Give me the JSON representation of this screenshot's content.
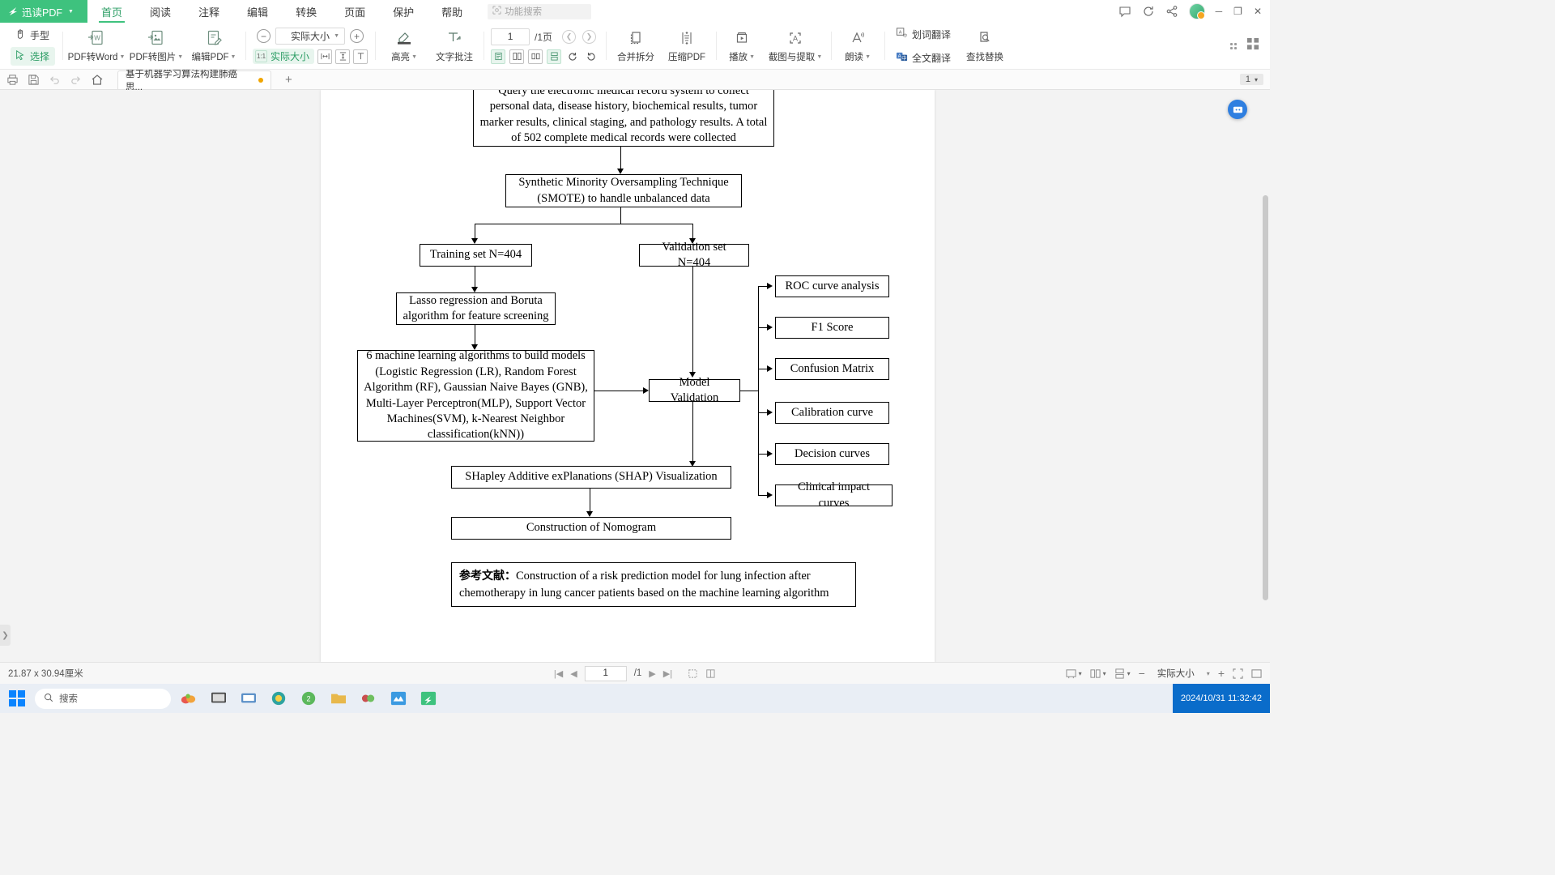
{
  "app": {
    "brand": "迅读PDF",
    "menu_tabs": [
      {
        "label": "首页",
        "active": true
      },
      {
        "label": "阅读",
        "active": false
      },
      {
        "label": "注释",
        "active": false
      },
      {
        "label": "编辑",
        "active": false
      },
      {
        "label": "转换",
        "active": false
      },
      {
        "label": "页面",
        "active": false
      },
      {
        "label": "保护",
        "active": false
      },
      {
        "label": "帮助",
        "active": false
      }
    ],
    "func_search_placeholder": "功能搜索",
    "window_buttons": {
      "minimize": "─",
      "maximize": "❐",
      "close": "✕"
    },
    "accent": "#3ec27e"
  },
  "ribbon": {
    "hand_tool": "手型",
    "select_tool": "选择",
    "pdf_to_word": "PDF转Word",
    "pdf_to_image": "PDF转图片",
    "edit_pdf": "编辑PDF",
    "zoom_out": "−",
    "zoom_value": "实际大小",
    "zoom_in": "+",
    "actual_size": "实际大小",
    "fit_width": "适合宽度",
    "fit_page": "适合页面",
    "text_fit": "文本适合",
    "highlight": "高亮",
    "text_annotate": "文字批注",
    "page_current": "1",
    "page_total": "/1页",
    "merge_split": "合并拆分",
    "compress_pdf": "压缩PDF",
    "play": "播放",
    "screenshot_extract": "截图与提取",
    "read_aloud": "朗读",
    "word_translate": "划词翻译",
    "full_translate": "全文翻译",
    "find_replace": "查找替换"
  },
  "tabbar": {
    "doc_title": "基于机器学习算法构建肺癌思...",
    "add_tab": "+",
    "page_chip": "1"
  },
  "document": {
    "flow_nodes": [
      {
        "id": "collect",
        "text": "Query the electronic medical record system to collect personal data, disease history, biochemical results, tumor marker results, clinical staging, and pathology results. A total of 502 complete medical records were collected"
      },
      {
        "id": "smote",
        "text": "Synthetic Minority Oversampling Technique (SMOTE) to handle unbalanced data"
      },
      {
        "id": "training",
        "text": "Training set N=404"
      },
      {
        "id": "validation",
        "text": "Validation set N=404"
      },
      {
        "id": "lasso",
        "text": "Lasso regression and Boruta algorithm for feature screening"
      },
      {
        "id": "models",
        "text": "6 machine learning algorithms to build models (Logistic Regression (LR), Random Forest Algorithm (RF), Gaussian Naive Bayes (GNB), Multi-Layer Perceptron(MLP), Support Vector Machines(SVM), k-Nearest Neighbor classification(kNN))"
      },
      {
        "id": "modelval",
        "text": "Model Validation"
      },
      {
        "id": "shap",
        "text": "SHapley Additive exPlanations (SHAP) Visualization"
      },
      {
        "id": "nomogram",
        "text": "Construction of Nomogram"
      }
    ],
    "metrics": [
      {
        "id": "roc",
        "text": "ROC curve analysis"
      },
      {
        "id": "f1",
        "text": "F1 Score"
      },
      {
        "id": "confusion",
        "text": "Confusion Matrix"
      },
      {
        "id": "calibration",
        "text": "Calibration curve"
      },
      {
        "id": "decision",
        "text": "Decision curves"
      },
      {
        "id": "clinical",
        "text": "Clinical impact curves"
      }
    ],
    "reference": {
      "label": "参考文献：",
      "text": "Construction of a risk prediction model for lung infection after chemotherapy in lung cancer patients based on the machine learning algorithm"
    }
  },
  "statusbar": {
    "dimensions": "21.87 x 30.94厘米",
    "first_page": "|◀",
    "prev_page": "◀",
    "page_value": "1",
    "page_total": "/1",
    "next_page": "▶",
    "last_page": "▶|",
    "zoom_out": "−",
    "zoom_label": "实际大小",
    "zoom_in": "+"
  },
  "taskbar": {
    "search_placeholder": "搜索",
    "clock": "2024/10/31 11:32:42"
  }
}
